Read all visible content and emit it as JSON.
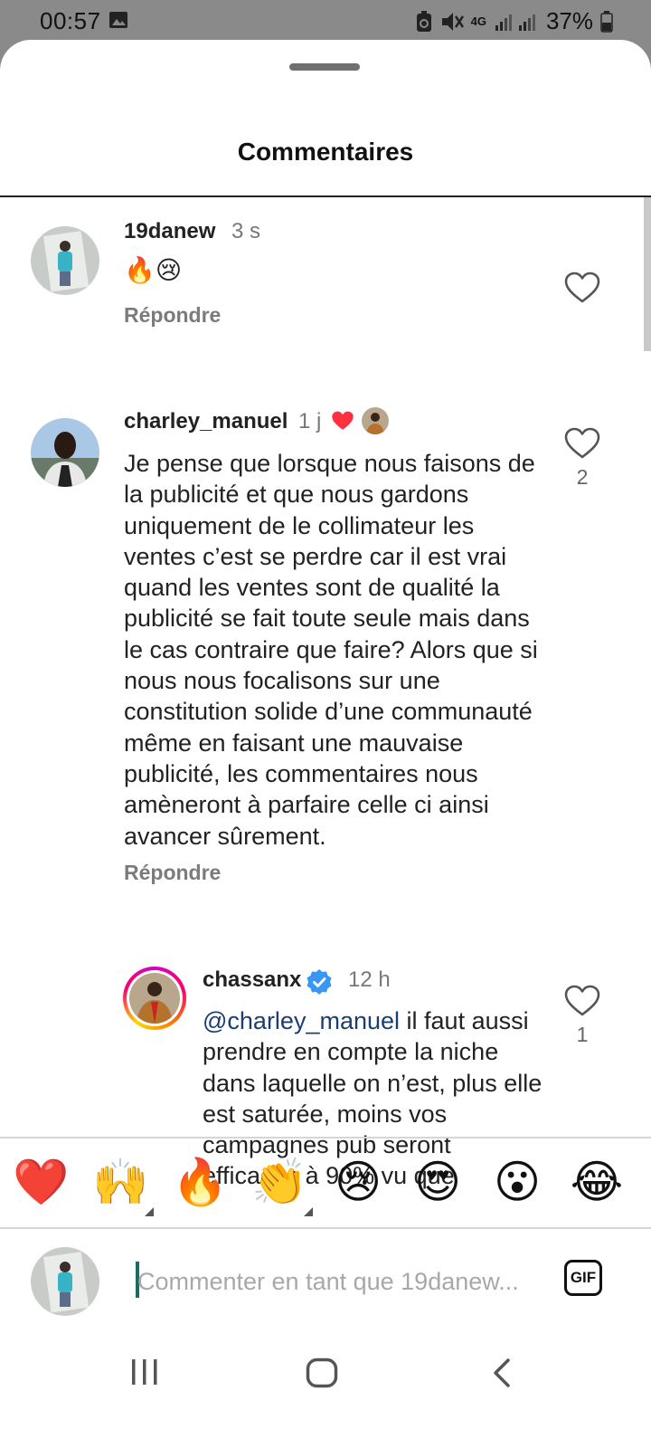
{
  "status_bar": {
    "time": "00:57",
    "network": "4G",
    "battery": "37%"
  },
  "sheet": {
    "title": "Commentaires"
  },
  "comments": [
    {
      "username": "19danew",
      "time": "3 s",
      "text": "🔥😢",
      "reply_label": "Répondre",
      "likes": ""
    },
    {
      "username": "charley_manuel",
      "time": "1 j",
      "text": "Je pense que lorsque nous faisons de la publicité et que nous gardons uniquement de le collimateur les ventes c’est se perdre car il est vrai quand les ventes sont de qualité la publicité se fait toute seule mais dans le cas contraire que faire? Alors que si nous nous focalisons sur une constitution solide d’une communauté même en faisant une mauvaise publicité, les commentaires nous amèneront à parfaire celle ci ainsi avancer sûrement.",
      "reply_label": "Répondre",
      "likes": "2",
      "author_liked": true
    }
  ],
  "reply": {
    "username": "chassanx",
    "verified": true,
    "time": "12 h",
    "mention": "@charley_manuel",
    "text": " il faut aussi prendre en compte la niche dans laquelle on n’est, plus elle est saturée, moins vos campagnes pub seront efficaces à 90% vu que",
    "likes": "1"
  },
  "quick_reactions": [
    "❤️",
    "🙌",
    "🔥",
    "👏",
    "😢",
    "😍",
    "😮",
    "😂"
  ],
  "composer": {
    "placeholder": "Commenter en tant que 19danew...",
    "gif_label": "GIF"
  },
  "colors": {
    "heart_red": "#ff3040",
    "verified_blue": "#3897f0",
    "mention_blue": "#1c3d70"
  }
}
